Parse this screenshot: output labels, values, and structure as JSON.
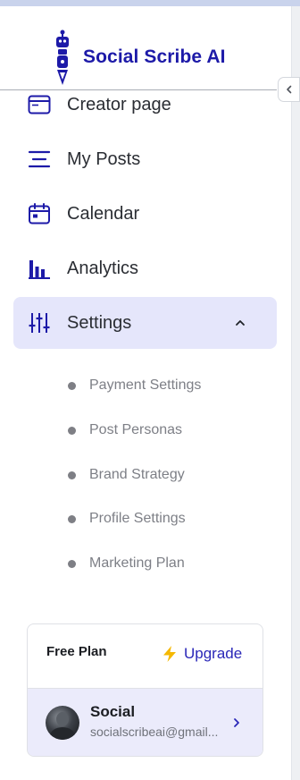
{
  "app": {
    "name": "Social Scribe AI"
  },
  "nav": {
    "items": [
      {
        "label": "Creator page",
        "icon": "browser-window-icon"
      },
      {
        "label": "My Posts",
        "icon": "text-lines-icon"
      },
      {
        "label": "Calendar",
        "icon": "calendar-icon"
      },
      {
        "label": "Analytics",
        "icon": "bar-chart-icon"
      },
      {
        "label": "Settings",
        "icon": "sliders-icon",
        "active": true,
        "expanded": true
      }
    ],
    "settings_sub": [
      {
        "label": "Payment Settings"
      },
      {
        "label": "Post Personas"
      },
      {
        "label": "Brand Strategy"
      },
      {
        "label": "Profile Settings"
      },
      {
        "label": "Marketing Plan"
      }
    ]
  },
  "plan": {
    "title": "Free Plan",
    "upgrade_label": "Upgrade"
  },
  "user": {
    "name": "Social",
    "email": "socialscribeai@gmail..."
  },
  "colors": {
    "brand": "#1d1aa8",
    "accent": "#2a27b8",
    "active_bg": "#e5e6fb",
    "upgrade_icon": "#f5b800"
  }
}
